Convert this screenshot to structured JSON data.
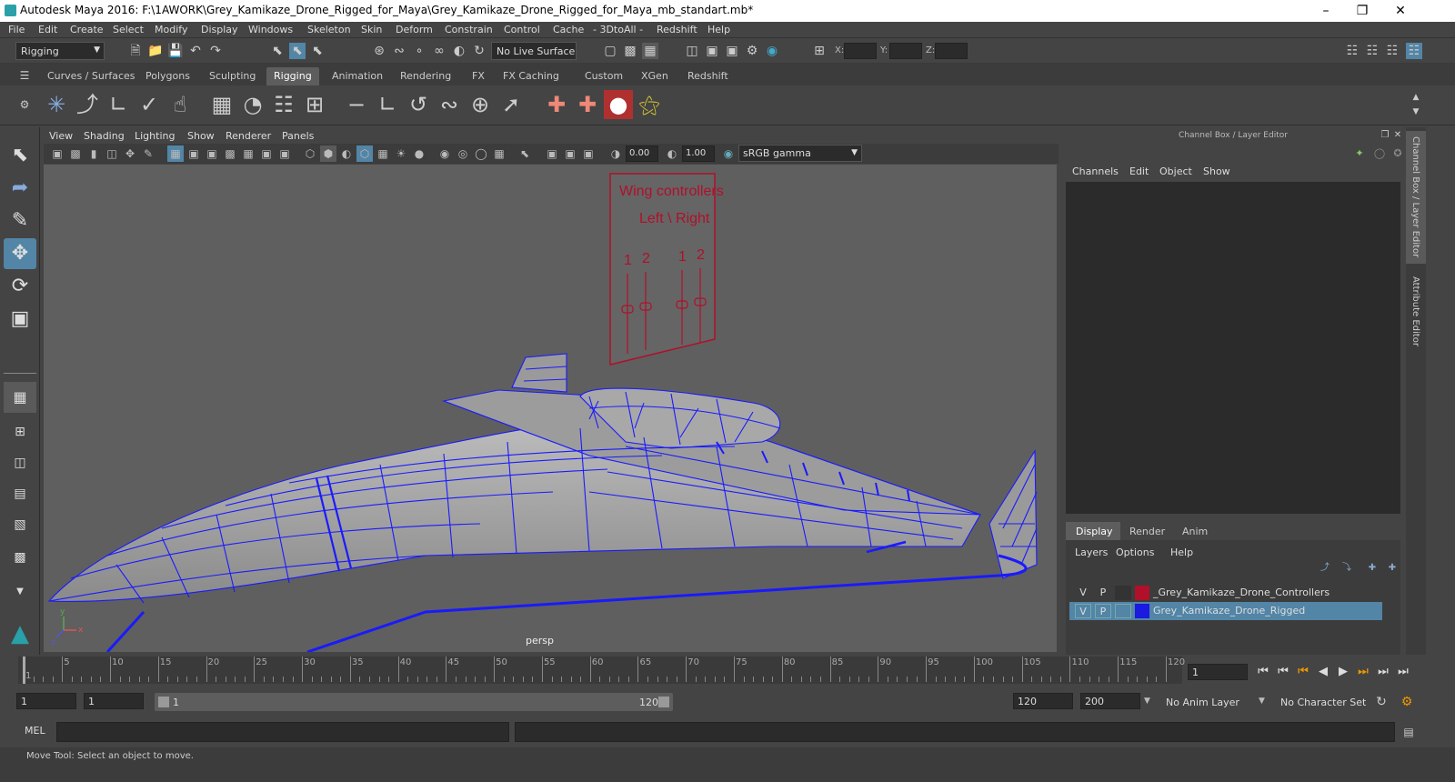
{
  "window": {
    "title": "Autodesk Maya 2016: F:\\1AWORK\\Grey_Kamikaze_Drone_Rigged_for_Maya\\Grey_Kamikaze_Drone_Rigged_for_Maya_mb_standart.mb*"
  },
  "menu": [
    "File",
    "Edit",
    "Create",
    "Select",
    "Modify",
    "Display",
    "Windows",
    "Skeleton",
    "Skin",
    "Deform",
    "Constrain",
    "Control",
    "Cache",
    "- 3DtoAll -",
    "Redshift",
    "Help"
  ],
  "status": {
    "mode": "Rigging",
    "live_surface": "No Live Surface",
    "x_label": "X:",
    "y_label": "Y:",
    "z_label": "Z:"
  },
  "shelf_tabs": [
    "Curves / Surfaces",
    "Polygons",
    "Sculpting",
    "Rigging",
    "Animation",
    "Rendering",
    "FX",
    "FX Caching",
    "Custom",
    "XGen",
    "Redshift"
  ],
  "shelf_active": "Rigging",
  "panel_menu": [
    "View",
    "Shading",
    "Lighting",
    "Show",
    "Renderer",
    "Panels"
  ],
  "panel_toolbar": {
    "exposure": "0.00",
    "gamma": "1.00",
    "color_space": "sRGB gamma"
  },
  "viewport": {
    "camera": "persp",
    "controller_title_1": "Wing controllers",
    "controller_title_2": "Left \\ Right",
    "slider_labels": [
      "1",
      "2",
      "1",
      "2"
    ],
    "axis_labels": {
      "y": "y",
      "x": "x",
      "z": "z"
    }
  },
  "channel_box": {
    "title": "Channel Box / Layer Editor",
    "menu": [
      "Channels",
      "Edit",
      "Object",
      "Show"
    ],
    "layer_tabs": [
      "Display",
      "Render",
      "Anim"
    ],
    "layer_menu": [
      "Layers",
      "Options",
      "Help"
    ],
    "layers": [
      {
        "v": "V",
        "p": "P",
        "name": "_Grey_Kamikaze_Drone_Controllers",
        "color": "#b0102a",
        "selected": false
      },
      {
        "v": "V",
        "p": "P",
        "name": "Grey_Kamikaze_Drone_Rigged",
        "color": "#1a1ae0",
        "selected": true
      }
    ]
  },
  "side_tabs": [
    "Channel Box / Layer Editor",
    "Attribute Editor"
  ],
  "timeline": {
    "ticks": [
      "5",
      "10",
      "15",
      "20",
      "25",
      "30",
      "35",
      "40",
      "45",
      "50",
      "55",
      "60",
      "65",
      "70",
      "75",
      "80",
      "85",
      "90",
      "95",
      "100",
      "105",
      "110",
      "115",
      "120"
    ],
    "start_label": "1",
    "current_frame": "1"
  },
  "range": {
    "start": "1",
    "start2": "1",
    "slider_start": "1",
    "slider_end": "120",
    "end": "120",
    "end2": "200",
    "anim_layer": "No Anim Layer",
    "character_set": "No Character Set"
  },
  "command": {
    "lang": "MEL"
  },
  "help_line": "Move Tool: Select an object to move.",
  "colors": {
    "wire": "#1a1aff",
    "controller": "#b0102a",
    "selection": "#5285a6"
  }
}
